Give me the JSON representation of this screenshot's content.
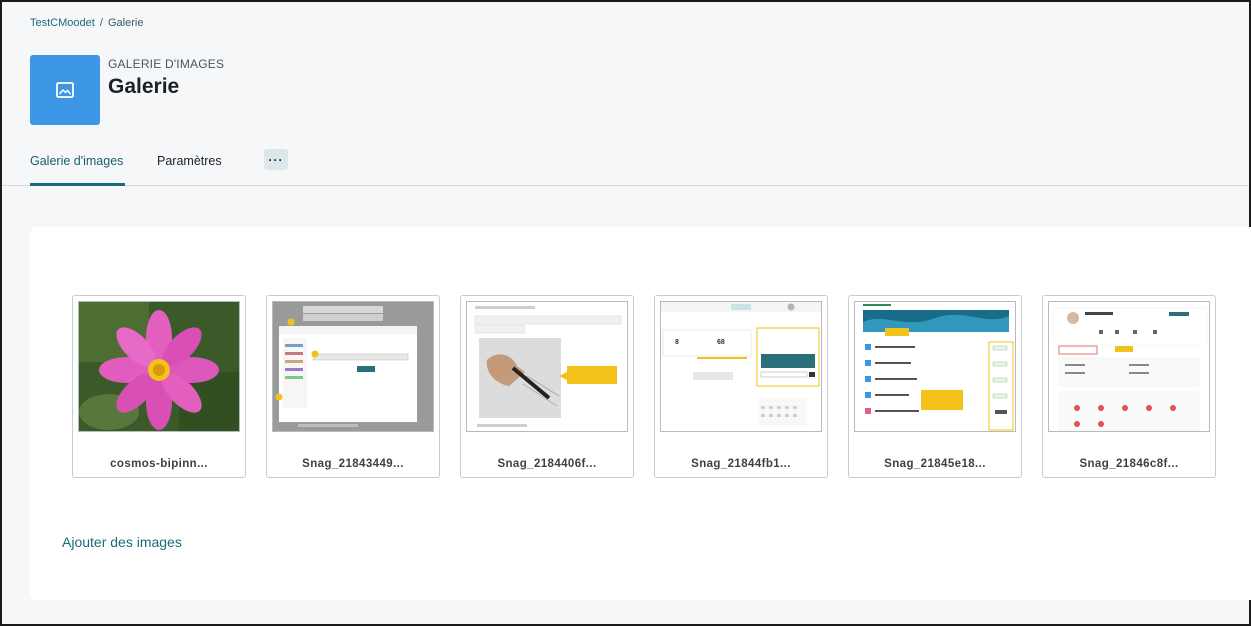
{
  "breadcrumb": {
    "items": [
      "TestCMoodet",
      "Galerie"
    ],
    "separator": "/"
  },
  "header": {
    "pretitle": "GALERIE D'IMAGES",
    "title": "Galerie",
    "icon": "image-icon",
    "icon_color": "#3d97e6"
  },
  "tabs": [
    {
      "label": "Galerie d'images",
      "active": true
    },
    {
      "label": "Paramètres",
      "active": false
    }
  ],
  "more_button": "···",
  "gallery": {
    "items": [
      {
        "label": "cosmos-bipinn...",
        "thumb": "flower"
      },
      {
        "label": "Snag_21843449...",
        "thumb": "screenshot-dialog"
      },
      {
        "label": "Snag_2184406f...",
        "thumb": "screenshot-pen"
      },
      {
        "label": "Snag_21844fb1...",
        "thumb": "screenshot-dashboard"
      },
      {
        "label": "Snag_21845e18...",
        "thumb": "screenshot-course"
      },
      {
        "label": "Snag_21846c8f...",
        "thumb": "screenshot-profile"
      }
    ]
  },
  "add_images": "Ajouter des images",
  "colors": {
    "accent": "#1a6b7a",
    "page_bg": "#f5f7f9"
  }
}
